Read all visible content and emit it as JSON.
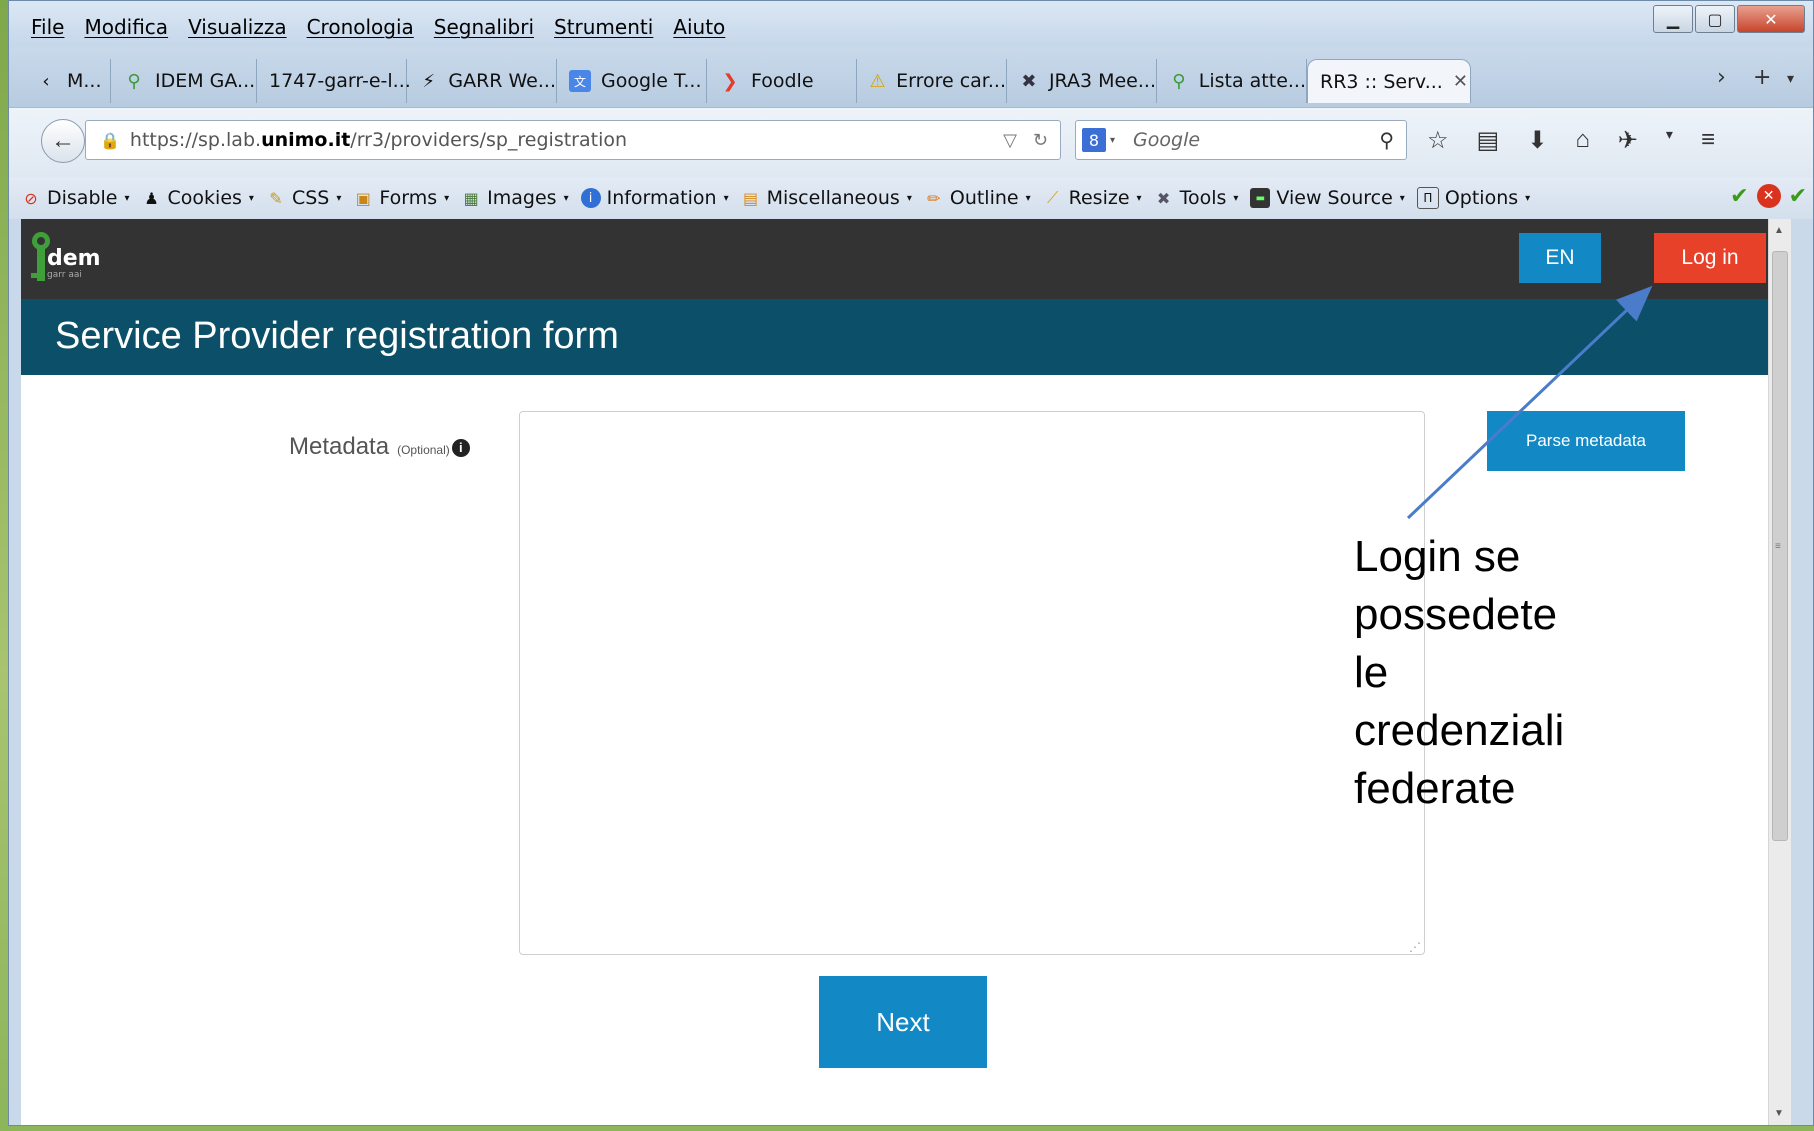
{
  "menubar": {
    "items": [
      "File",
      "Modifica",
      "Visualizza",
      "Cronologia",
      "Segnalibri",
      "Strumenti",
      "Aiuto"
    ]
  },
  "tabs": [
    {
      "label": "M...",
      "icon": "chevron-left-icon"
    },
    {
      "label": "IDEM GA...",
      "icon": "idem-icon"
    },
    {
      "label": "1747-garr-e-l...",
      "icon": ""
    },
    {
      "label": "GARR We...",
      "icon": "garr-icon"
    },
    {
      "label": "Google T...",
      "icon": "google-translate-icon"
    },
    {
      "label": "Foodle",
      "icon": "foodle-icon"
    },
    {
      "label": "Errore car...",
      "icon": "warning-icon"
    },
    {
      "label": "JRA3 Mee...",
      "icon": "tools-icon"
    },
    {
      "label": "Lista atte...",
      "icon": "idem-icon"
    },
    {
      "label": "RR3 :: Serv...",
      "icon": "",
      "active": true
    }
  ],
  "navbar": {
    "url_prefix": "https://sp.lab.",
    "url_host": "unimo.it",
    "url_path": "/rr3/providers/sp_registration",
    "search_placeholder": "Google"
  },
  "devbar": {
    "items": [
      "Disable",
      "Cookies",
      "CSS",
      "Forms",
      "Images",
      "Information",
      "Miscellaneous",
      "Outline",
      "Resize",
      "Tools",
      "View Source",
      "Options"
    ]
  },
  "site": {
    "lang_button": "EN",
    "login_button": "Log in",
    "page_title": "Service Provider registration form",
    "metadata_label": "Metadata",
    "metadata_optional": "(Optional)",
    "parse_button": "Parse metadata",
    "next_button": "Next"
  },
  "annotation": {
    "lines": [
      "Login se",
      "possedete",
      "le",
      "credenziali",
      "federate"
    ]
  },
  "colors": {
    "header_bg": "#333333",
    "title_band": "#0b5068",
    "primary_button": "#1289c4",
    "login_button": "#e8412a",
    "arrow": "#4a7cc9"
  }
}
